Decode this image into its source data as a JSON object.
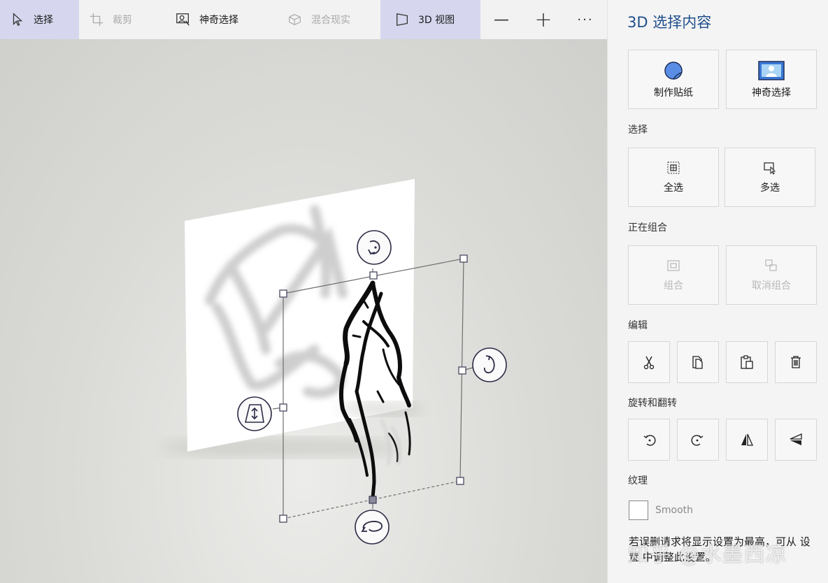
{
  "toolbar": {
    "select_label": "选择",
    "crop_label": "裁剪",
    "magic_select_label": "神奇选择",
    "mixed_reality_label": "混合现实",
    "view3d_label": "3D 视图",
    "zoom_out_glyph": "—",
    "zoom_in_glyph": "+",
    "more_glyph": "···"
  },
  "panel": {
    "title": "3D 选择内容",
    "make_sticker": "制作贴纸",
    "magic_select": "神奇选择",
    "select_heading": "选择",
    "select_all": "全选",
    "multi_select": "多选",
    "group_heading": "正在组合",
    "group": "组合",
    "ungroup": "取消组合",
    "edit_heading": "编辑",
    "rotate_flip_heading": "旋转和翻转",
    "texture_heading": "纹理",
    "smooth_label": "Smooth",
    "note": "若误删请求将显示设置为最高，可从 设置 中调整此设置。"
  },
  "watermark": "知乎 @水墨西凉",
  "colors": {
    "toolbar_bg": "#f2f2f2",
    "active_tab_bg": "#d6d7ee",
    "panel_title": "#1f4e8c",
    "handle_stroke": "#2b2b45"
  },
  "icons": {
    "select": "cursor-icon",
    "crop": "crop-icon",
    "magic_select": "magic-select-icon",
    "mixed_reality": "mixed-reality-icon",
    "view3d": "view-3d-icon",
    "cut": "scissors-icon",
    "copy": "copy-icon",
    "paste": "paste-icon",
    "delete": "trash-icon"
  }
}
